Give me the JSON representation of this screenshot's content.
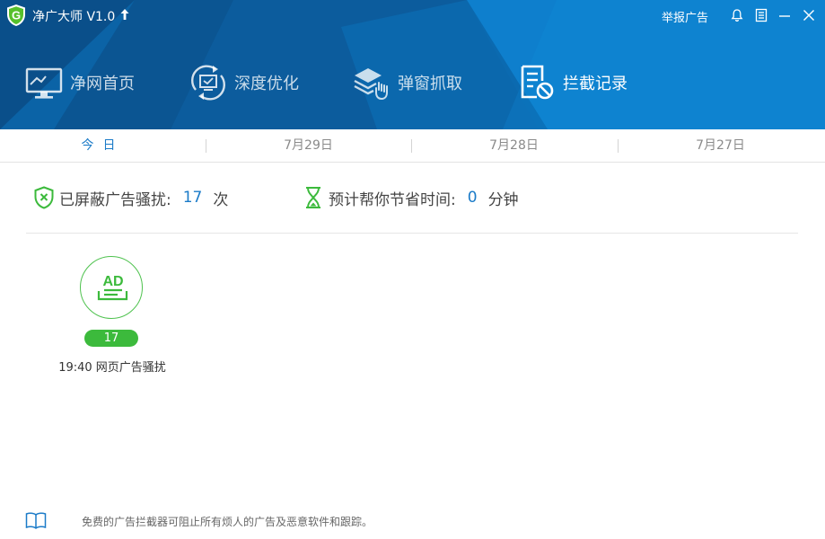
{
  "app": {
    "title": "净广大师 V1.0",
    "logo_letter": "G",
    "report_label": "举报广告"
  },
  "icons": {
    "logo": "shield-logo-icon",
    "upgrade": "arrow-up-icon",
    "bell": "bell-icon",
    "menu": "menu-icon",
    "minimize": "minimize-icon",
    "close": "close-icon"
  },
  "nav": {
    "items": [
      {
        "label": "净网首页",
        "icon": "monitor-icon"
      },
      {
        "label": "深度优化",
        "icon": "refresh-monitor-icon"
      },
      {
        "label": "弹窗抓取",
        "icon": "layers-hand-icon"
      },
      {
        "label": "拦截记录",
        "icon": "blocked-list-icon"
      }
    ],
    "active_index": 3
  },
  "date_tabs": {
    "items": [
      "今日",
      "7月29日",
      "7月28日",
      "7月27日"
    ],
    "active_index": 0
  },
  "stats": {
    "blocked_label": "已屏蔽广告骚扰:",
    "blocked_count": "17",
    "blocked_unit": "次",
    "saved_label": "预计帮你节省时间:",
    "saved_value": "0",
    "saved_unit": "分钟"
  },
  "records": [
    {
      "icon_text": "AD",
      "count": "17",
      "description": "19:40 网页广告骚扰"
    }
  ],
  "footer": {
    "text": "免费的广告拦截器可阻止所有烦人的广告及恶意软件和跟踪。"
  },
  "colors": {
    "header_blue": "#0a66ab",
    "accent_blue": "#1b7bc8",
    "green": "#3cba3c"
  }
}
